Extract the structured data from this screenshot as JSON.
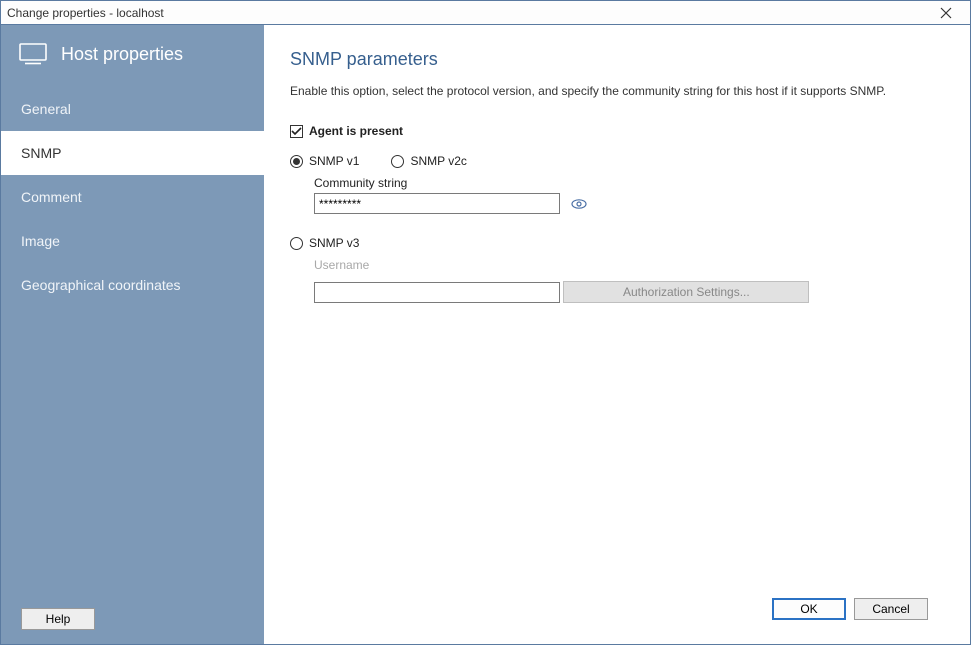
{
  "window": {
    "title": "Change properties - localhost"
  },
  "sidebar": {
    "title": "Host properties",
    "items": [
      {
        "label": "General",
        "active": false
      },
      {
        "label": "SNMP",
        "active": true
      },
      {
        "label": "Comment",
        "active": false
      },
      {
        "label": "Image",
        "active": false
      },
      {
        "label": "Geographical coordinates",
        "active": false
      }
    ],
    "help_label": "Help"
  },
  "page": {
    "title": "SNMP parameters",
    "description": "Enable this option, select the protocol version, and specify the community string for this host if it supports SNMP."
  },
  "agent": {
    "label": "Agent is present",
    "checked": true
  },
  "versions": {
    "v1_label": "SNMP v1",
    "v2c_label": "SNMP v2c",
    "v3_label": "SNMP v3",
    "selected": "v1"
  },
  "community": {
    "label": "Community string",
    "value": "*********"
  },
  "v3": {
    "username_label": "Username",
    "username_value": "",
    "auth_button_label": "Authorization Settings..."
  },
  "buttons": {
    "ok": "OK",
    "cancel": "Cancel"
  }
}
